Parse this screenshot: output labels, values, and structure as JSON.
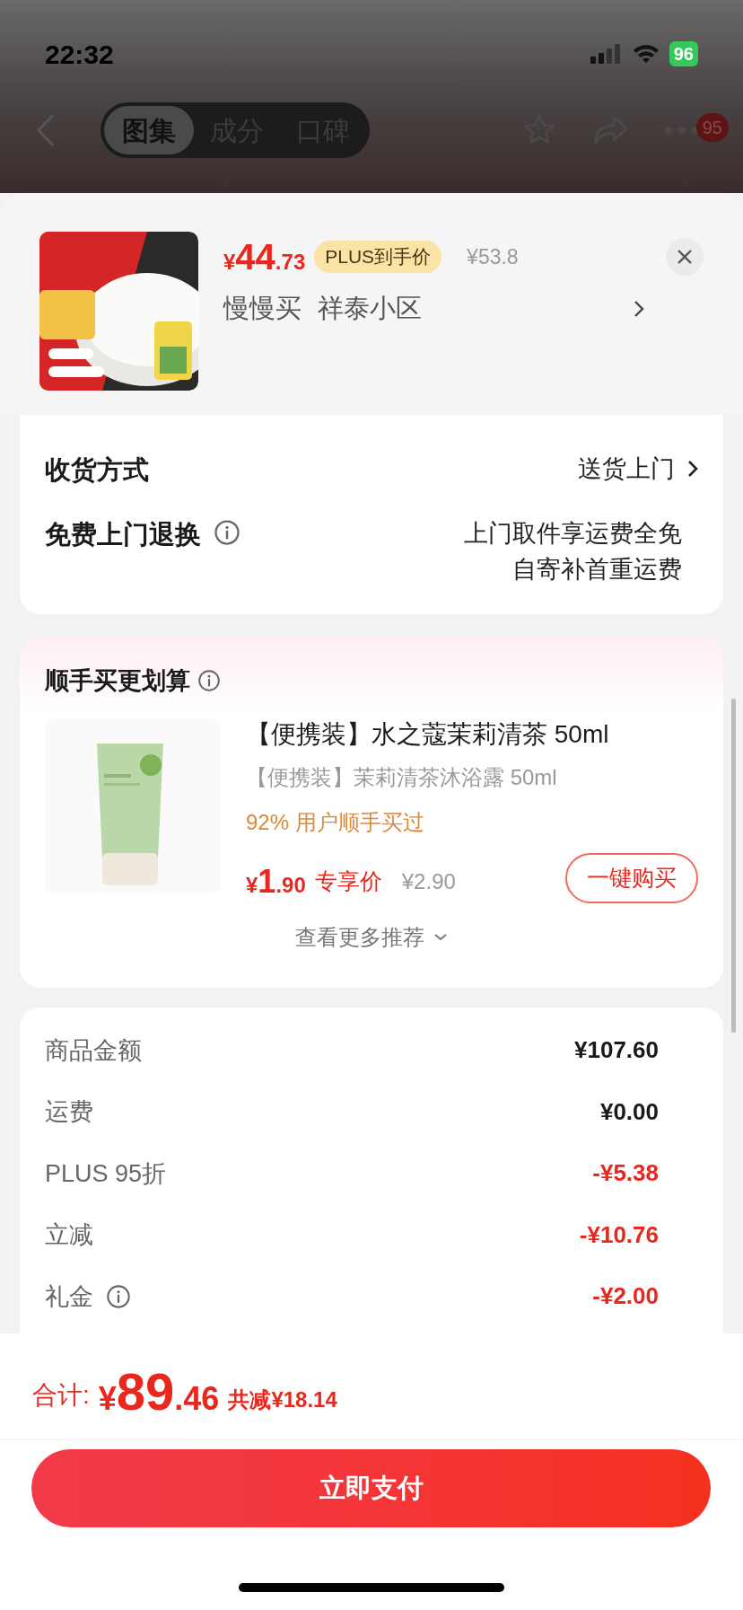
{
  "status_bar": {
    "time": "22:32",
    "battery": "96"
  },
  "nav": {
    "tabs": [
      {
        "label": "图集",
        "selected": true
      },
      {
        "label": "成分",
        "selected": false
      },
      {
        "label": "口碑",
        "selected": false
      }
    ],
    "badge": "95"
  },
  "product_header": {
    "price": {
      "symbol": "¥",
      "integer": "44",
      "decimal": ".73"
    },
    "tag": "PLUS到手价",
    "original_price": "¥53.8",
    "address": [
      "慢慢买",
      "祥泰小区"
    ]
  },
  "delivery": [
    {
      "kind": "link",
      "label": "收货方式",
      "lines": [
        "送货上门"
      ]
    },
    {
      "kind": "info",
      "label": "免费上门退换",
      "lines": [
        "上门取件享运费全免",
        "自寄补首重运费"
      ]
    }
  ],
  "bundle": {
    "title": "顺手买更划算",
    "product": {
      "title": "【便携装】水之蔻茉莉清茶 50ml",
      "subtitle": "【便携装】茉莉清茶沐浴露 50ml",
      "stat": "92% 用户顺手买过",
      "price": {
        "symbol": "¥",
        "integer": "1",
        "decimal": ".90"
      },
      "price_label": "专享价",
      "original_price": "¥2.90",
      "button": "一键购买"
    },
    "more": "查看更多推荐"
  },
  "summary": [
    {
      "kind": "charge",
      "label": "商品金额",
      "value": "¥107.60",
      "info": false
    },
    {
      "kind": "charge",
      "label": "运费",
      "value": "¥0.00",
      "info": false
    },
    {
      "kind": "discount",
      "label": "PLUS 95折",
      "value": "-¥5.38",
      "info": false
    },
    {
      "kind": "discount",
      "label": "立减",
      "value": "-¥10.76",
      "info": false
    },
    {
      "kind": "discount",
      "label": "礼金",
      "value": "-¥2.00",
      "info": true
    }
  ],
  "footer": {
    "label": "合计:",
    "total": {
      "symbol": "¥",
      "integer": "89",
      "decimal": ".46"
    },
    "saved": "共减¥18.14",
    "pay_button": "立即支付"
  }
}
